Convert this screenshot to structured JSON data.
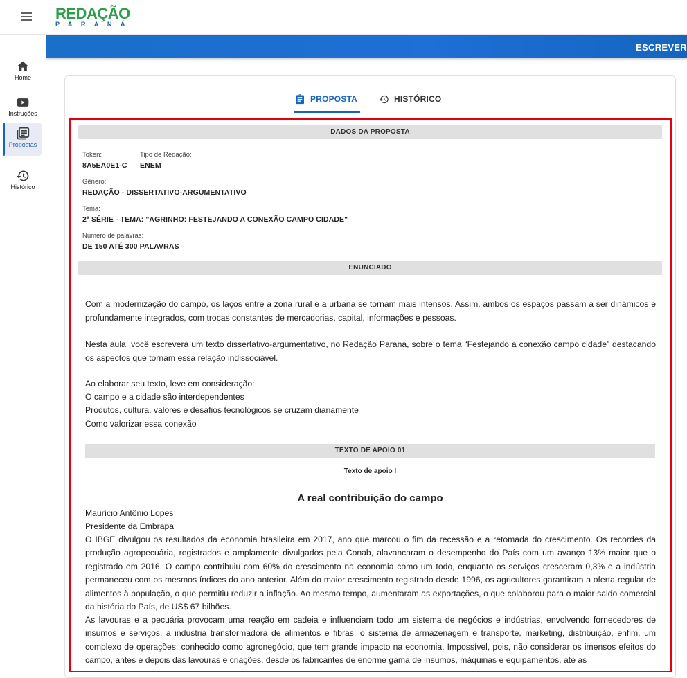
{
  "app": {
    "logo_top": "REDAÇÃO",
    "logo_bottom": "PARANÁ"
  },
  "sidebar": {
    "items": [
      {
        "label": "Home",
        "icon": "home-icon",
        "active": false
      },
      {
        "label": "Instruções",
        "icon": "video-icon",
        "active": false
      },
      {
        "label": "Propostas",
        "icon": "propostas-icon",
        "active": true
      },
      {
        "label": "Histórico",
        "icon": "history-icon",
        "active": false
      }
    ]
  },
  "banner": {
    "action_label": "ESCREVER"
  },
  "tabs": [
    {
      "label": "PROPOSTA",
      "icon": "clipboard-icon",
      "active": true
    },
    {
      "label": "HISTÓRICO",
      "icon": "history-icon",
      "active": false
    }
  ],
  "dados": {
    "section_title": "DADOS DA PROPOSTA",
    "token_label": "Token:",
    "token_value": "8A5EA0E1-C",
    "tipo_label": "Tipo de Redação:",
    "tipo_value": "ENEM",
    "genero_label": "Gênero:",
    "genero_value": "REDAÇÃO - DISSERTATIVO-ARGUMENTATIVO",
    "tema_label": "Tema:",
    "tema_value": "2ª SÉRIE - TEMA: \"AGRINHO: FESTEJANDO A CONEXÃO CAMPO CIDADE\"",
    "palavras_label": "Número de palavras:",
    "palavras_value": "DE 150 ATÉ 300 PALAVRAS"
  },
  "enunciado": {
    "section_title": "ENUNCIADO",
    "p1": "Com a modernização do campo, os laços entre a zona rural e a urbana se tornam mais intensos. Assim, ambos os espaços passam a ser dinâmicos e profundamente integrados, com trocas constantes de mercadorias, capital, informações e pessoas.",
    "p2": "Nesta aula, você escreverá um texto dissertativo-argumentativo, no Redação Paraná, sobre o tema “Festejando a conexão campo cidade” destacando os aspectos que tornam essa relação indissociável.",
    "lines": [
      "Ao elaborar seu texto, leve em consideração:",
      "O campo e a cidade são interdependentes",
      "Produtos, cultura, valores e desafios tecnológicos se cruzam diariamente",
      "Como valorizar essa conexão"
    ]
  },
  "apoio": {
    "section_title": "TEXTO DE APOIO 01",
    "subtitle": "Texto de apoio I",
    "article_title": "A real contribuição do campo",
    "author": "Maurício Antônio Lopes",
    "role": "Presidente da Embrapa",
    "p1": "O IBGE divulgou os resultados da economia brasileira em 2017, ano que marcou o fim da recessão e a retomada do crescimento. Os recordes da produção agropecuária, registrados e amplamente divulgados pela Conab, alavancaram o desempenho do País com um avanço 13% maior que o registrado em 2016. O campo contribuiu com 60% do crescimento na economia como um todo, enquanto os serviços cresceram 0,3% e a indústria permaneceu com os mesmos índices do ano anterior. Além do maior crescimento registrado desde 1996, os agricultores garantiram a oferta regular de alimentos à população, o que permitiu reduzir a inflação. Ao mesmo tempo, aumentaram as exportações, o que colaborou para o maior saldo comercial da história do País, de US$ 67 bilhões.",
    "p2": "As lavouras e a pecuária provocam uma reação em cadeia e influenciam todo um sistema de negócios e indústrias, envolvendo fornecedores de insumos e serviços, a indústria transformadora de alimentos e fibras, o sistema de armazenagem e transporte, marketing, distribuição, enfim, um complexo de operações, conhecido como agronegócio, que tem grande impacto na economia. Impossível, pois, não considerar os imensos efeitos do campo, antes e depois das lavouras e criações, desde os fabricantes de enorme gama de insumos, máquinas e equipamentos, até as"
  }
}
